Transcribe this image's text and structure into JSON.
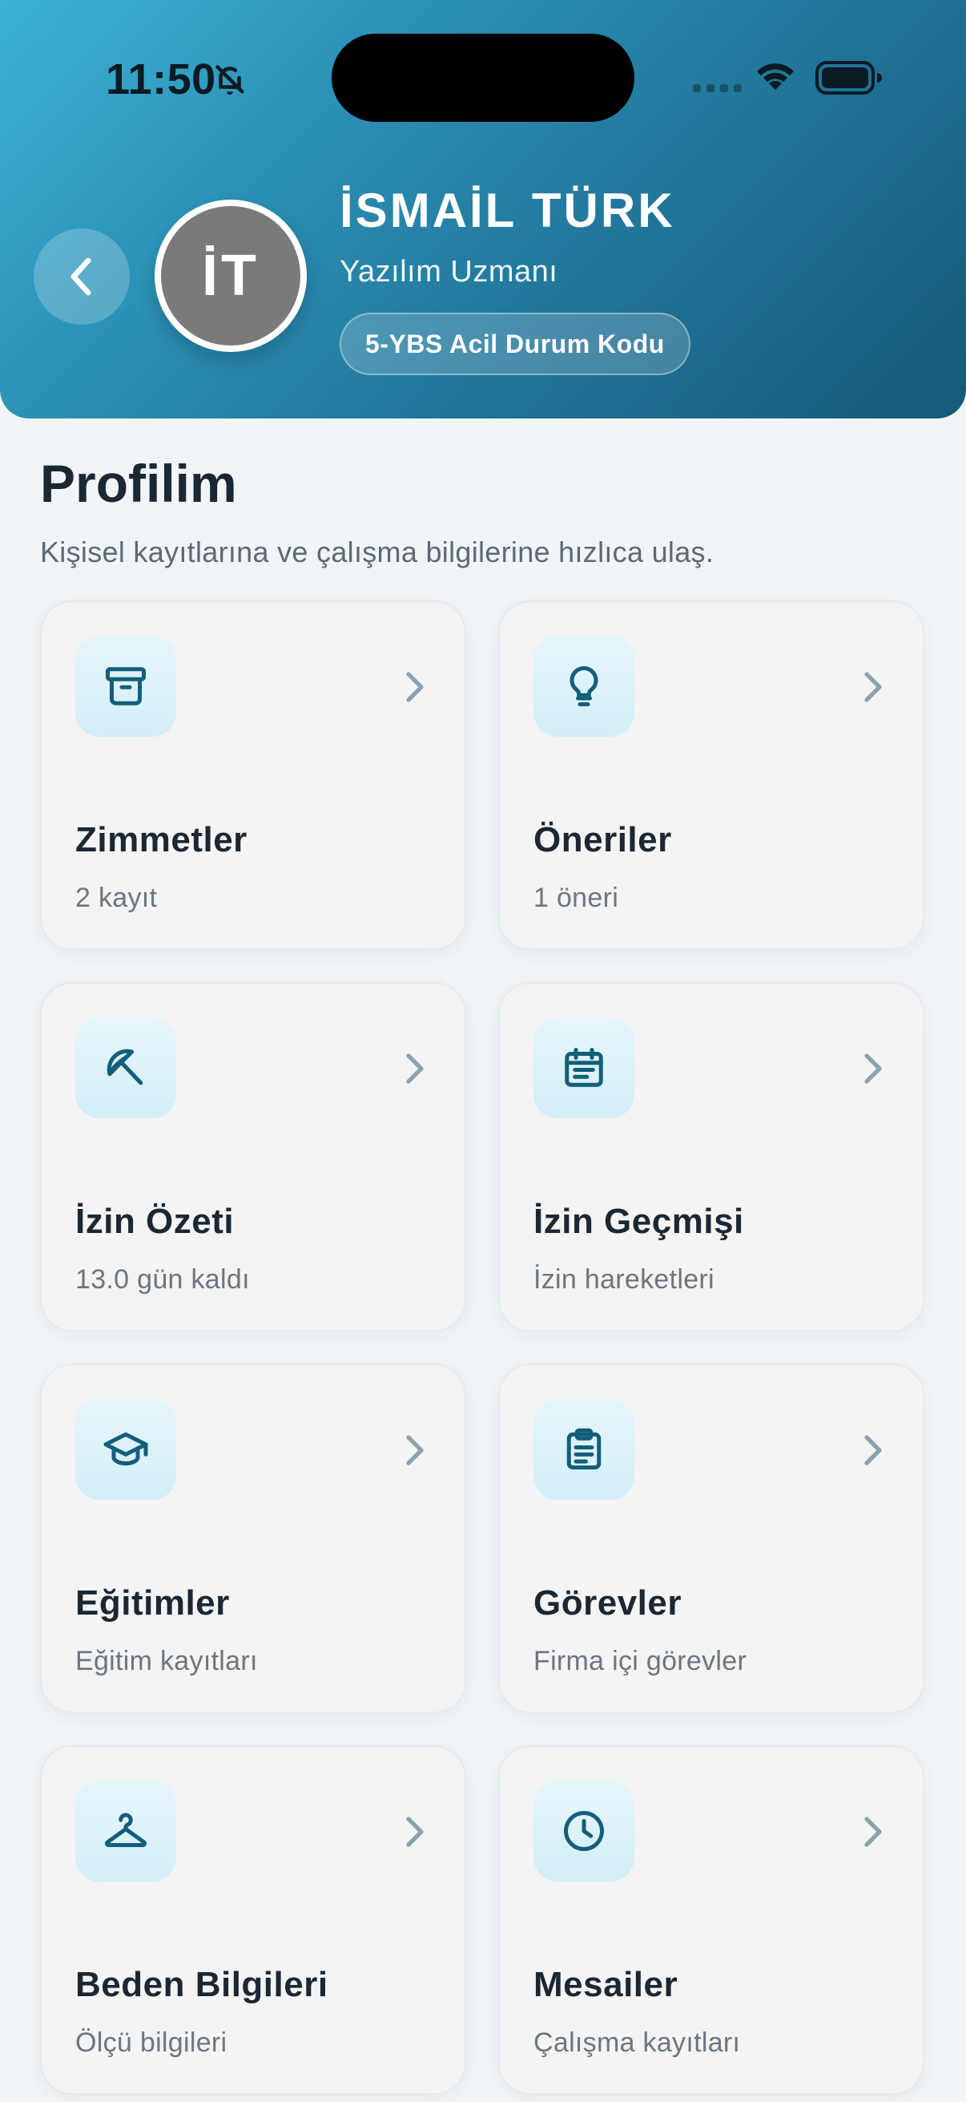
{
  "status_bar": {
    "time": "11:50"
  },
  "profile": {
    "initials": "İT",
    "name": "İSMAİL TÜRK",
    "role": "Yazılım Uzmanı",
    "code_badge": "5-YBS Acil Durum Kodu"
  },
  "page": {
    "title": "Profilim",
    "subtitle": "Kişisel kayıtlarına ve çalışma bilgilerine hızlıca ulaş."
  },
  "colors": {
    "header_gradient_start": "#3bb2d7",
    "header_gradient_end": "#155a78",
    "icon_color": "#135e7a",
    "chevron_color": "#8aa2b0"
  },
  "cards": [
    {
      "title": "Zimmetler",
      "subtitle": "2 kayıt",
      "icon": "archive-icon"
    },
    {
      "title": "Öneriler",
      "subtitle": "1 öneri",
      "icon": "lightbulb-icon"
    },
    {
      "title": "İzin Özeti",
      "subtitle": "13.0 gün kaldı",
      "icon": "umbrella-icon"
    },
    {
      "title": "İzin Geçmişi",
      "subtitle": "İzin hareketleri",
      "icon": "calendar-icon"
    },
    {
      "title": "Eğitimler",
      "subtitle": "Eğitim kayıtları",
      "icon": "graduation-cap-icon"
    },
    {
      "title": "Görevler",
      "subtitle": "Firma içi görevler",
      "icon": "clipboard-icon"
    },
    {
      "title": "Beden Bilgileri",
      "subtitle": "Ölçü bilgileri",
      "icon": "hanger-icon"
    },
    {
      "title": "Mesailer",
      "subtitle": "Çalışma kayıtları",
      "icon": "clock-icon"
    }
  ]
}
